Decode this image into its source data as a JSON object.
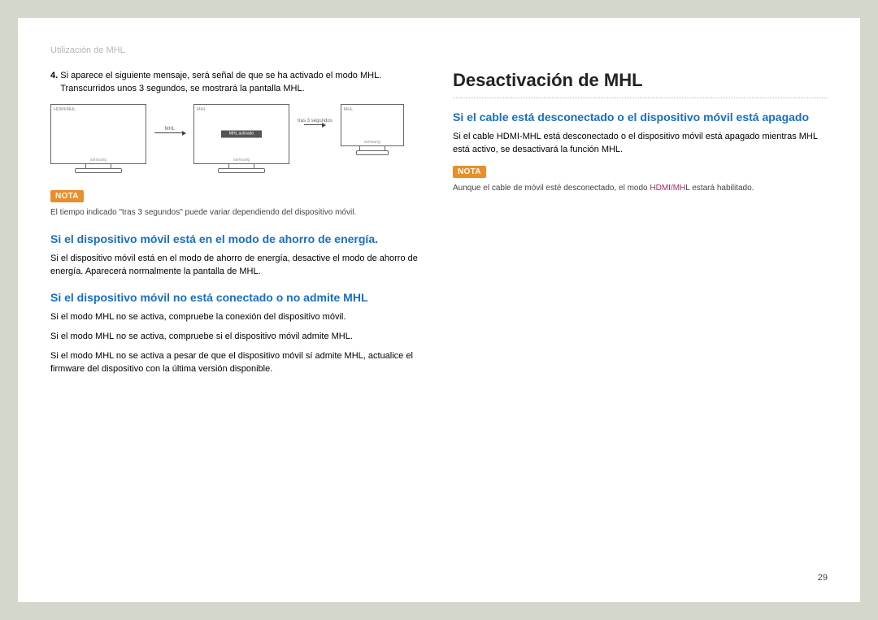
{
  "header": "Utilización de MHL",
  "pageNumber": "29",
  "left": {
    "item4": {
      "num": "4.",
      "line1": "Si aparece el siguiente mensaje, será señal de que se ha activado el modo MHL.",
      "line2": "Transcurridos unos 3 segundos, se mostrará la pantalla MHL."
    },
    "monitors": {
      "m1_label": "HDMI/MHL",
      "arrow1": "MHL",
      "m2_label": "MHL",
      "m2_box": "MHL activado",
      "arrow2": "tras 3 segundos",
      "m3_label": "MHL",
      "brand": "samsung"
    },
    "nota1": {
      "badge": "NOTA",
      "text": "El tiempo indicado \"tras 3 segundos\" puede variar dependiendo del dispositivo móvil."
    },
    "h_energy": "Si el dispositivo móvil está en el modo de ahorro de energía.",
    "p_energy": "Si el dispositivo móvil está en el modo de ahorro de energía, desactive el modo de ahorro de energía. Aparecerá normalmente la pantalla de MHL.",
    "h_noconn": "Si el dispositivo móvil no está conectado o no admite MHL",
    "p_noconn1": "Si el modo MHL no se activa, compruebe la conexión del dispositivo móvil.",
    "p_noconn2": "Si el modo MHL no se activa, compruebe si el dispositivo móvil admite MHL.",
    "p_noconn3": "Si el modo MHL no se activa a pesar de que el dispositivo móvil sí admite MHL, actualice el firmware del dispositivo con la última versión disponible."
  },
  "right": {
    "h1": "Desactivación de MHL",
    "h2": "Si el cable está desconectado o el dispositivo móvil está apagado",
    "p1": "Si el cable HDMI-MHL está desconectado o el dispositivo móvil está apagado mientras MHL está activo, se desactivará la función MHL.",
    "nota": {
      "badge": "NOTA",
      "pre": "Aunque el cable de móvil esté desconectado, el modo ",
      "magenta": "HDMI/MH",
      "post": "L estará habilitado."
    }
  }
}
